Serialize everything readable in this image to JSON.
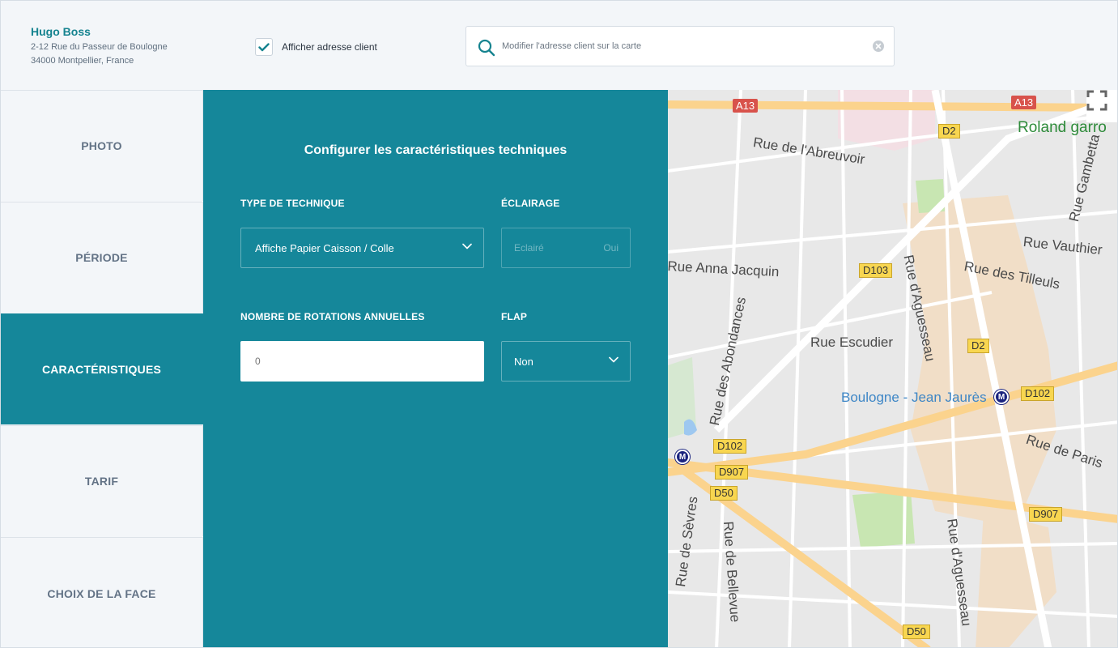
{
  "client": {
    "name": "Hugo Boss",
    "address_line1": "2-12 Rue du Passeur de Boulogne",
    "address_line2": "34000 Montpellier, France"
  },
  "show_address": {
    "label": "Afficher adresse client",
    "checked": true
  },
  "search": {
    "placeholder": "Modifier l'adresse client sur la carte",
    "value": ""
  },
  "sidebar": {
    "items": [
      {
        "label": "PHOTO",
        "active": false
      },
      {
        "label": "PÉRIODE",
        "active": false
      },
      {
        "label": "CARACTÉRISTIQUES",
        "active": true
      },
      {
        "label": "TARIF",
        "active": false
      },
      {
        "label": "CHOIX DE LA FACE",
        "active": false
      }
    ]
  },
  "panel": {
    "title": "Configurer les caractéristiques techniques",
    "technique_label": "TYPE DE TECHNIQUE",
    "technique_value": "Affiche Papier Caisson / Colle",
    "eclairage_label": "ÉCLAIRAGE",
    "eclairage_left": "Eclairé",
    "eclairage_right": "Oui",
    "rotations_label": "NOMBRE DE ROTATIONS ANNUELLES",
    "rotations_value": "0",
    "flap_label": "FLAP",
    "flap_value": "Non"
  },
  "map": {
    "place_labels": [
      "Rue de l'Abreuvoir",
      "Roland garro",
      "Rue Gambetta",
      "Rue Vauthier",
      "Rue Anna Jacquin",
      "Rue des Tilleuls",
      "Rue d'Aguesseau",
      "Rue Escudier",
      "Rue des Abondances",
      "Boulogne - Jean Jaurès",
      "Rue de Paris",
      "Rue de Sèvres",
      "Rue de Bellevue",
      "Rue d'Aguesseau"
    ],
    "road_badges": [
      "D2",
      "D103",
      "D2",
      "D102",
      "D102",
      "D907",
      "D50",
      "D907",
      "D50"
    ],
    "highway_badges": [
      "A13",
      "A13"
    ],
    "colors": {
      "water": "#9ec8f0",
      "park": "#c8e6b2",
      "road_major": "#fbd38d",
      "road_minor": "#ffffff"
    }
  },
  "colors": {
    "accent": "#15879a",
    "brand_text": "#15838f"
  }
}
